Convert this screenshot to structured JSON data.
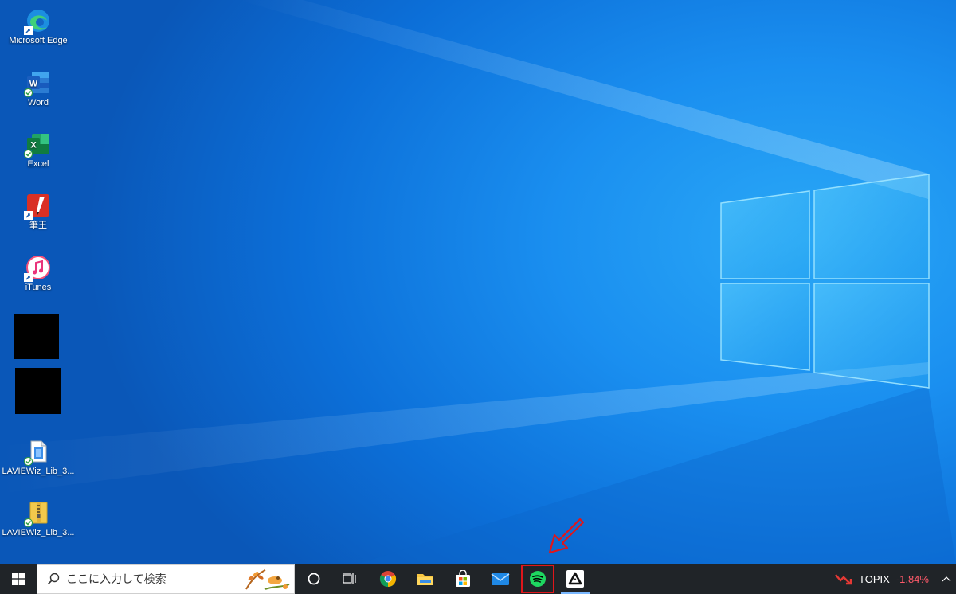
{
  "desktop": {
    "icons": [
      {
        "label": "Microsoft Edge",
        "icon": "edge-icon",
        "overlay": "shortcut"
      },
      {
        "label": "Word",
        "icon": "word-icon",
        "overlay": "check"
      },
      {
        "label": "Excel",
        "icon": "excel-icon",
        "overlay": "check"
      },
      {
        "label": "筆王",
        "icon": "fudeou-icon",
        "overlay": "shortcut"
      },
      {
        "label": "iTunes",
        "icon": "itunes-icon",
        "overlay": "shortcut"
      },
      {
        "label": "LAVIEWiz_Lib_3...",
        "icon": "document-icon",
        "overlay": "check"
      },
      {
        "label": "LAVIEWiz_Lib_3...",
        "icon": "zip-folder-icon",
        "overlay": "check"
      }
    ]
  },
  "taskbar": {
    "start_icon": "windows-logo-icon",
    "search_placeholder": "ここに入力して検索",
    "pinned": [
      "cortana-icon",
      "task-view-icon",
      "chrome-icon",
      "file-explorer-icon",
      "microsoft-store-icon",
      "mail-icon",
      "spotify-icon",
      "app-icon"
    ],
    "highlighted_app": "spotify-icon",
    "news": {
      "label": "TOPIX",
      "value": "-1.84%"
    },
    "colors": {
      "highlight_box": "#e0161b",
      "negative": "#ff5a6a",
      "spotify": "#1ed760"
    }
  }
}
